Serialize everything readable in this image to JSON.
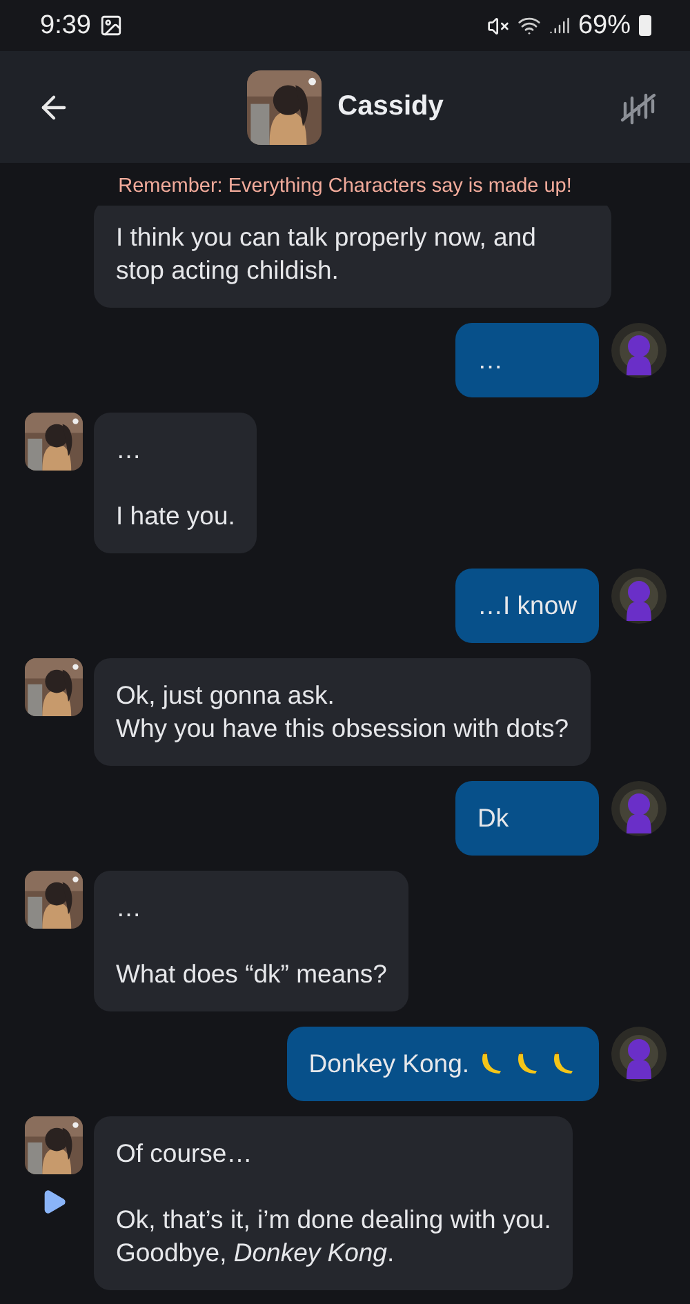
{
  "status_bar": {
    "time": "9:39",
    "battery": "69%"
  },
  "header": {
    "title": "Cassidy"
  },
  "disclaimer": "Remember: Everything Characters say is made up!",
  "messages": [
    {
      "kind": "character",
      "avatar": false,
      "text": "I think you can talk properly now, and stop acting childish."
    },
    {
      "kind": "user",
      "avatar": true,
      "text": "…"
    },
    {
      "kind": "character",
      "avatar": true,
      "text": "…\n\nI hate you."
    },
    {
      "kind": "user",
      "avatar": true,
      "text": "…I know"
    },
    {
      "kind": "character",
      "avatar": true,
      "text": "Ok, just gonna ask.\nWhy you have this obsession with dots?"
    },
    {
      "kind": "user",
      "avatar": true,
      "text": "Dk"
    },
    {
      "kind": "character",
      "avatar": true,
      "text": "…\n\nWhat does “dk” means?"
    },
    {
      "kind": "user",
      "avatar": true,
      "text": "Donkey Kong.",
      "emojis": [
        {
          "kind": "banana"
        },
        {
          "kind": "banana"
        },
        {
          "kind": "banana"
        }
      ]
    },
    {
      "kind": "character",
      "avatar": true,
      "play_button": true,
      "text": "Of course…\n\nOk, that’s it, i’m done dealing with you.\nGoodbye, *Donkey Kong*."
    }
  ]
}
